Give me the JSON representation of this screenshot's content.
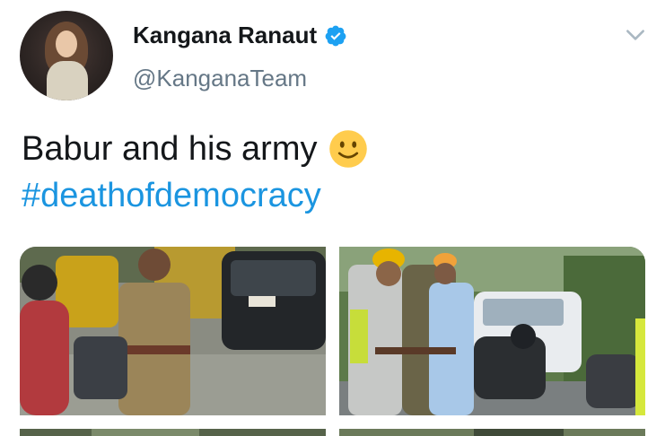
{
  "author": {
    "display_name": "Kangana Ranaut",
    "handle": "@KanganaTeam",
    "verified": true
  },
  "tweet": {
    "text": "Babur and his army",
    "emoji": "slightly-smiling-face",
    "hashtag": "#deathofdemocracy"
  },
  "media": {
    "photos": [
      {
        "subject": "police officer beside scooter and black car"
      },
      {
        "subject": "workers in hard hats beside white car and motorbike"
      },
      {
        "subject": "additional photo (partially visible)"
      },
      {
        "subject": "additional photo (partially visible)"
      }
    ]
  },
  "icons": {
    "verified": "verified-badge-icon",
    "menu": "chevron-down-icon",
    "emoji": "smiling-face-icon"
  },
  "colors": {
    "hashtag": "#1b95e0",
    "handle": "#657786",
    "verified": "#1da1f2",
    "text": "#14171a"
  }
}
